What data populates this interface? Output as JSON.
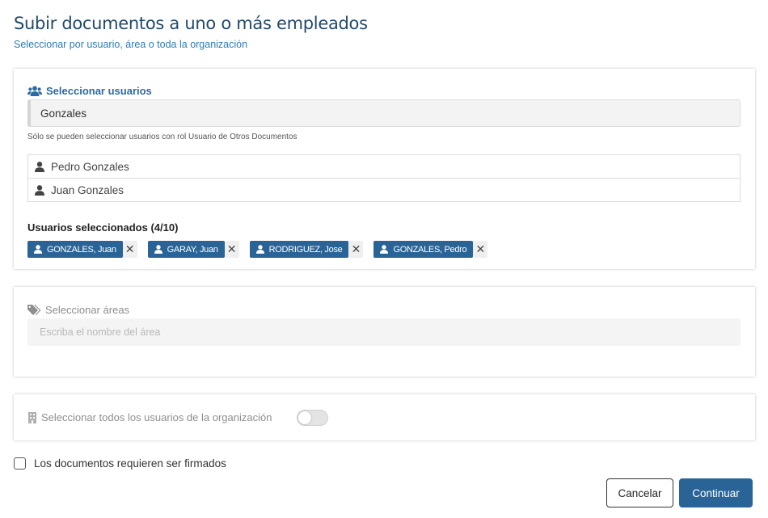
{
  "header": {
    "title": "Subir documentos a uno o más empleados",
    "subtitle": "Seleccionar por usuario, área o toda la organización"
  },
  "users_section": {
    "label": "Seleccionar usuarios",
    "icon": "users-icon",
    "search_value": "Gonzales",
    "hint": "Sólo se pueden seleccionar usuarios con rol Usuario de Otros Documentos",
    "results": [
      "Pedro Gonzales",
      "Juan Gonzales"
    ],
    "selected_title": "Usuarios seleccionados (4/10)",
    "selected": [
      "GONZALES, Juan",
      "GARAY, Juan",
      "RODRIGUEZ, Jose",
      "GONZALES, Pedro"
    ]
  },
  "areas_section": {
    "label": "Seleccionar áreas",
    "icon": "tags-icon",
    "placeholder": "Escriba el nombre del área"
  },
  "org_section": {
    "label": "Seleccionar todos los usuarios de la organización",
    "icon": "building-icon",
    "toggle_on": false
  },
  "sign_checkbox": {
    "label": "Los documentos requieren ser firmados",
    "checked": false
  },
  "actions": {
    "cancel_label": "Cancelar",
    "continue_label": "Continuar"
  },
  "colors": {
    "primary": "#2a6496",
    "title": "#23496b",
    "subtitle": "#2f7bb5"
  }
}
